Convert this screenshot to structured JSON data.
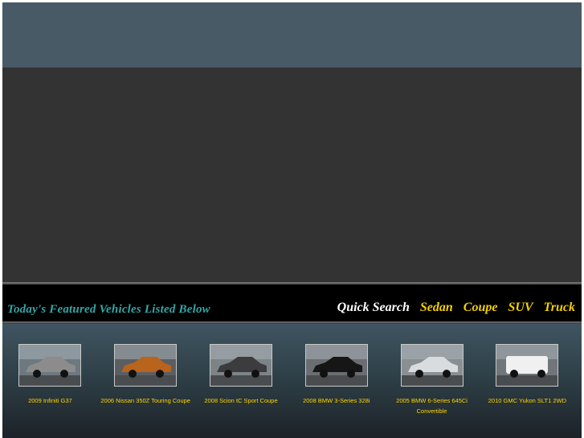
{
  "featured_bar": {
    "title": "Today's Featured Vehicles Listed Below",
    "quick_search_label": "Quick Search",
    "categories": [
      "Sedan",
      "Coupe",
      "SUV",
      "Truck"
    ]
  },
  "vehicles": [
    {
      "title": "2009 Infiniti G37",
      "car_color": "#8c8c8c",
      "bg": "#6d7880"
    },
    {
      "title": "2006 Nissan 350Z Touring Coupe",
      "car_color": "#b8641c",
      "bg": "#5a5e62"
    },
    {
      "title": "2008 Scion tC Sport Coupe",
      "car_color": "#3c3c3e",
      "bg": "#7d8488"
    },
    {
      "title": "2008 BMW 3-Series 328i",
      "car_color": "#161616",
      "bg": "#6a6e72"
    },
    {
      "title": "2005 BMW 6-Series 645Ci Convertible",
      "car_color": "#d9dcdf",
      "bg": "#8a8f93"
    },
    {
      "title": "2010 GMC Yukon SLT1 2WD",
      "car_color": "#f0f0f0",
      "bg": "#70767a"
    }
  ],
  "colors": {
    "header": "#475a66",
    "hero": "#333333",
    "bar": "#000000",
    "title_text": "#33a6a6",
    "category_text": "#f2d000",
    "caption_text": "#ffd400"
  }
}
